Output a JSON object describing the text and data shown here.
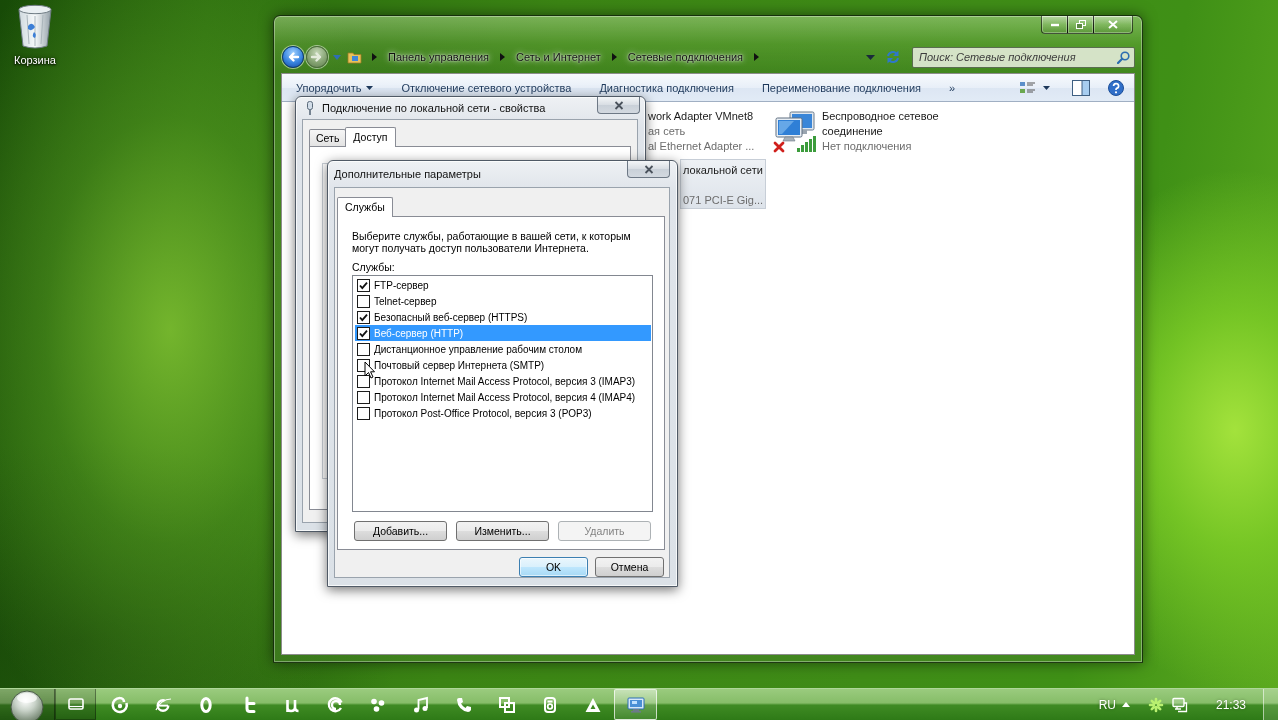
{
  "desktop": {
    "icons": [
      {
        "label": "Корзина"
      }
    ]
  },
  "explorer": {
    "nav_buttons": [
      {
        "kind": "back",
        "disabled": false
      },
      {
        "kind": "forward",
        "disabled": true
      }
    ],
    "breadcrumb": [
      "Панель управления",
      "Сеть и Интернет",
      "Сетевые подключения"
    ],
    "search": {
      "placeholder": "Поиск: Сетевые подключения"
    },
    "commands": [
      {
        "label": "Упорядочить",
        "kind": "menu"
      },
      {
        "label": "Отключение сетевого устройства",
        "kind": "command"
      },
      {
        "label": "Диагностика подключения",
        "kind": "command"
      },
      {
        "label": "Переименование подключения",
        "kind": "command"
      },
      {
        "label": "»",
        "kind": "overflow"
      }
    ],
    "connections": [
      {
        "kind": "covered",
        "name": "work Adapter VMnet8",
        "status": "ая сеть",
        "device": "al Ethernet Adapter ...",
        "selected": false
      },
      {
        "kind": "wireless",
        "name": "Беспроводное сетевое соединение",
        "status": "Нет подключения",
        "selected": false
      },
      {
        "kind": "covered",
        "name": "локальной сети",
        "device": "071 PCI-E Gig...",
        "selected": true
      }
    ]
  },
  "properties_dialog": {
    "title": "Подключение по локальной сети - свойства",
    "tabs": [
      {
        "label": "Сеть",
        "selected": false
      },
      {
        "label": "Доступ",
        "selected": true
      }
    ]
  },
  "advanced_dialog": {
    "title": "Дополнительные параметры",
    "tabs": [
      {
        "label": "Службы",
        "selected": true
      }
    ],
    "description": "Выберите службы, работающие в вашей сети, к которым могут получать доступ пользователи Интернета.",
    "list_label": "Службы:",
    "services": [
      {
        "label": "FTP-сервер",
        "checked": true,
        "selected": false
      },
      {
        "label": "Telnet-сервер",
        "checked": false,
        "selected": false
      },
      {
        "label": "Безопасный веб-сервер (HTTPS)",
        "checked": true,
        "selected": false
      },
      {
        "label": "Веб-сервер (HTTP)",
        "checked": true,
        "selected": true
      },
      {
        "label": "Дистанционное управление рабочим столом",
        "checked": false,
        "selected": false
      },
      {
        "label": "Почтовый сервер Интернета (SMTP)",
        "checked": false,
        "selected": false
      },
      {
        "label": "Протокол Internet Mail Access Protocol, версия 3 (IMAP3)",
        "checked": false,
        "selected": false
      },
      {
        "label": "Протокол Internet Mail Access Protocol, версия 4 (IMAP4)",
        "checked": false,
        "selected": false
      },
      {
        "label": "Протокол Post-Office Protocol, версия 3 (POP3)",
        "checked": false,
        "selected": false
      }
    ],
    "list_buttons": [
      {
        "label": "Добавить...",
        "disabled": false
      },
      {
        "label": "Изменить...",
        "disabled": false
      },
      {
        "label": "Удалить",
        "disabled": true
      }
    ],
    "buttons": [
      {
        "label": "OK",
        "default": true
      },
      {
        "label": "Отмена",
        "default": false
      }
    ]
  },
  "taskbar": {
    "buttons": [
      {
        "kind": "window",
        "active": false
      },
      {
        "kind": "swirl",
        "active": false
      },
      {
        "kind": "e-logo",
        "active": false
      },
      {
        "kind": "oval",
        "active": false
      },
      {
        "kind": "t-logo",
        "active": false
      },
      {
        "kind": "mu-logo",
        "active": false
      },
      {
        "kind": "spiral",
        "active": false
      },
      {
        "kind": "dots",
        "active": false
      },
      {
        "kind": "note",
        "active": false
      },
      {
        "kind": "phone",
        "active": false
      },
      {
        "kind": "squares",
        "active": false
      },
      {
        "kind": "tile",
        "active": false
      },
      {
        "kind": "triangle",
        "active": false
      },
      {
        "kind": "monitor",
        "active": true
      }
    ],
    "tray": {
      "language": "RU",
      "clock": "21:33"
    }
  }
}
